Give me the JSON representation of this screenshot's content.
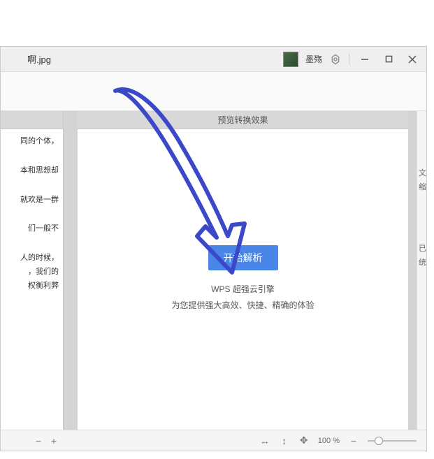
{
  "titlebar": {
    "filename": "啊.jpg",
    "username": "墨殇"
  },
  "left_doc": {
    "lines": [
      "同的个体，",
      "本和思想却",
      "",
      "就欢是一群",
      "",
      "们一般不",
      "",
      "人的时候，\n，我们的\n权衡利弊"
    ]
  },
  "right_panel": {
    "header": "预览转换效果",
    "button": "开始解析",
    "line1": "WPS 超强云引擎",
    "line2": "为您提供强大高效、快捷、精确的体验"
  },
  "sidebar": {
    "t1": "文档",
    "t2": "缩",
    "t3": "已",
    "t4": "统"
  },
  "status": {
    "zoom": "100 %"
  }
}
